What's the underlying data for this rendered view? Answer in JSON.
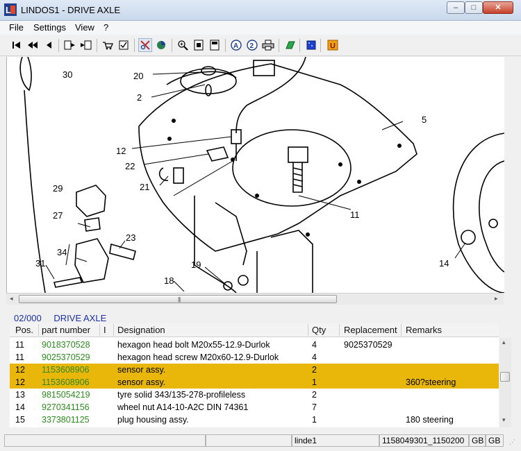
{
  "window": {
    "title": "LINDOS1 - DRIVE AXLE",
    "minimize": "–",
    "maximize": "□",
    "close": "✕"
  },
  "menu": [
    "File",
    "Settings",
    "View",
    "?"
  ],
  "toolbar": {
    "icons": [
      "first-icon",
      "previous-page-icon",
      "previous-icon",
      "export-icon",
      "import-icon",
      "cart-icon",
      "checklist-icon",
      "filter-icon",
      "color-icon",
      "zoom-icon",
      "page-icon",
      "page2-icon",
      "a-icon",
      "two-icon",
      "print-icon",
      "green-icon",
      "blue-icon",
      "u-icon"
    ]
  },
  "drawing": {
    "callouts": [
      "30",
      "20",
      "2",
      "5",
      "12",
      "22",
      "21",
      "29",
      "27",
      "34",
      "31",
      "23",
      "19",
      "18",
      "11",
      "14"
    ]
  },
  "parts": {
    "code": "02/000",
    "title": "DRIVE AXLE",
    "columns": [
      "Pos.",
      "part number",
      "I",
      "Designation",
      "Qty",
      "Replacement",
      "Remarks"
    ],
    "rows": [
      {
        "pos": "11",
        "part": "9018370528",
        "designation": "hexagon head bolt M20x55-12.9-Durlok",
        "qty": "4",
        "replacement": "9025370529",
        "remarks": "",
        "selected": false
      },
      {
        "pos": "11",
        "part": "9025370529",
        "designation": "hexagon head screw M20x60-12.9-Durlok",
        "qty": "4",
        "replacement": "",
        "remarks": "",
        "selected": false
      },
      {
        "pos": "12",
        "part": "1153608906",
        "designation": "sensor assy.",
        "qty": "2",
        "replacement": "",
        "remarks": "",
        "selected": true
      },
      {
        "pos": "12",
        "part": "1153608906",
        "designation": "sensor assy.",
        "qty": "1",
        "replacement": "",
        "remarks": "360?steering",
        "selected": true
      },
      {
        "pos": "13",
        "part": "9815054219",
        "designation": "tyre solid 343/135-278-profileless",
        "qty": "2",
        "replacement": "",
        "remarks": "",
        "selected": false
      },
      {
        "pos": "14",
        "part": "9270341156",
        "designation": "wheel nut A14-10-A2C  DIN 74361",
        "qty": "7",
        "replacement": "",
        "remarks": "",
        "selected": false
      },
      {
        "pos": "15",
        "part": "3373801125",
        "designation": "plug housing assy.",
        "qty": "1",
        "replacement": "",
        "remarks": "180 steering",
        "selected": false
      }
    ]
  },
  "status": {
    "user": "linde1",
    "doc": "1158049301_1150200",
    "lang1": "GB",
    "lang2": "GB"
  },
  "colors": {
    "selected_row": "#e8b70a",
    "part_number": "#2d8a1f",
    "header_text": "#1c2fa8"
  }
}
